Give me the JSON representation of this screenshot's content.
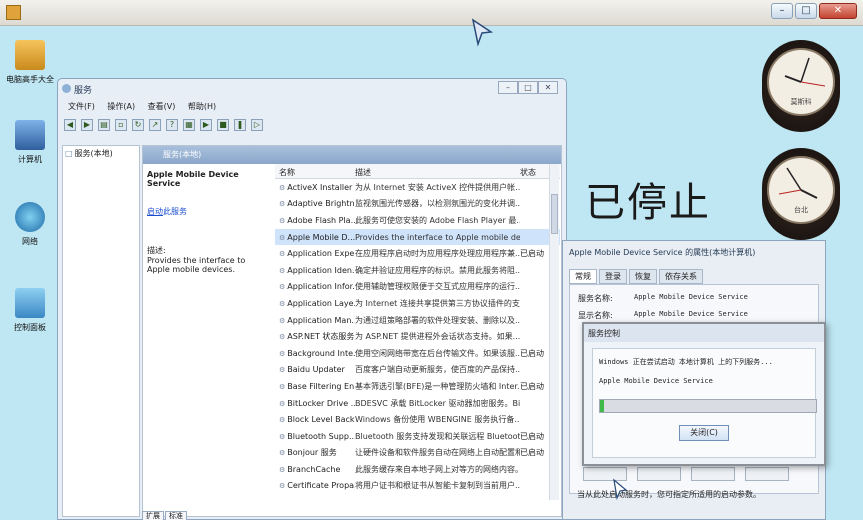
{
  "desktop": {
    "icons": [
      {
        "label": "电脑高手大全"
      },
      {
        "label": "计算机"
      },
      {
        "label": "网络"
      },
      {
        "label": "控制面板"
      }
    ],
    "clocks": [
      {
        "label": "莫斯科"
      },
      {
        "label": "台北"
      }
    ],
    "status_text": "已停止"
  },
  "services_window": {
    "title": "服务",
    "menu": [
      "文件(F)",
      "操作(A)",
      "查看(V)",
      "帮助(H)"
    ],
    "tree_node": "服务(本地)",
    "panel_header": "服务(本地)",
    "selected_name": "Apple Mobile Device Service",
    "action_link_prefix": "启动",
    "action_link_suffix": "此服务",
    "desc_label": "描述:",
    "desc_text": "Provides the interface to Apple mobile devices.",
    "columns": {
      "name": "名称",
      "desc": "描述",
      "status": "状态"
    },
    "rows": [
      {
        "name": "ActiveX Installer ...",
        "desc": "为从 Internet 安装 ActiveX 控件提供用户帐...",
        "status": ""
      },
      {
        "name": "Adaptive Brightn...",
        "desc": "监视氛围光传感器，以检测氛围光的变化并调...",
        "status": ""
      },
      {
        "name": "Adobe Flash Pla...",
        "desc": "此服务可使您安装的 Adobe Flash Player 最...",
        "status": ""
      },
      {
        "name": "Apple Mobile D...",
        "desc": "Provides the interface to Apple mobile de...",
        "status": ""
      },
      {
        "name": "Application Expe...",
        "desc": "在应用程序启动时为应用程序处理应用程序兼...",
        "status": "已启动"
      },
      {
        "name": "Application Iden...",
        "desc": "确定并验证应用程序的标识。禁用此服务将阻...",
        "status": ""
      },
      {
        "name": "Application Infor...",
        "desc": "使用辅助管理权限便于交互式应用程序的运行...",
        "status": ""
      },
      {
        "name": "Application Laye...",
        "desc": "为 Internet 连接共享提供第三方协议插件的支...",
        "status": ""
      },
      {
        "name": "Application Man...",
        "desc": "为通过组策略部署的软件处理安装、删除以及...",
        "status": ""
      },
      {
        "name": "ASP.NET 状态服务",
        "desc": "为 ASP.NET 提供进程外会话状态支持。如果...",
        "status": ""
      },
      {
        "name": "Background Inte...",
        "desc": "使用空闲网络带宽在后台传输文件。如果该服...",
        "status": "已启动"
      },
      {
        "name": "Baidu Updater",
        "desc": "百度客户端自动更新服务，使百度的产品保持...",
        "status": ""
      },
      {
        "name": "Base Filtering En...",
        "desc": "基本筛选引擎(BFE)是一种管理防火墙和 Inter...",
        "status": "已启动"
      },
      {
        "name": "BitLocker Drive ...",
        "desc": "BDESVC 承载 BitLocker 驱动器加密服务。Bi...",
        "status": ""
      },
      {
        "name": "Block Level Back...",
        "desc": "Windows 备份使用 WBENGINE 服务执行备...",
        "status": ""
      },
      {
        "name": "Bluetooth Supp...",
        "desc": "Bluetooth 服务支持发现和关联远程 Bluetoot...",
        "status": "已启动"
      },
      {
        "name": "Bonjour 服务",
        "desc": "让硬件设备和软件服务自动在网络上自动配置和...",
        "status": "已启动"
      },
      {
        "name": "BranchCache",
        "desc": "此服务缓存来自本地子网上对等方的网络内容。",
        "status": ""
      },
      {
        "name": "Certificate Propa...",
        "desc": "将用户证书和根证书从智能卡复制到当前用户...",
        "status": ""
      }
    ],
    "bottom_tabs": [
      "扩展",
      "标准"
    ]
  },
  "properties_dialog": {
    "title": "Apple Mobile Device Service 的属性(本地计算机)",
    "tabs": [
      "常规",
      "登录",
      "恢复",
      "依存关系"
    ],
    "service_name_label": "服务名称:",
    "service_name_value": "Apple Mobile Device Service",
    "display_name_label": "显示名称:",
    "display_name_value": "Apple Mobile Device Service",
    "note": "当从此处启动服务时，您可指定所适用的启动参数。"
  },
  "control_dialog": {
    "title": "服务控制",
    "line1": "Windows 正在尝试启动 本地计算机 上的下列服务...",
    "line2": "Apple Mobile Device Service",
    "progress": 0.02,
    "close_label": "关闭(C)"
  },
  "colors": {
    "desktop_bg": "#bfe6f3",
    "progress": "#3fb94a",
    "selected_row": "#cfe3fb"
  }
}
